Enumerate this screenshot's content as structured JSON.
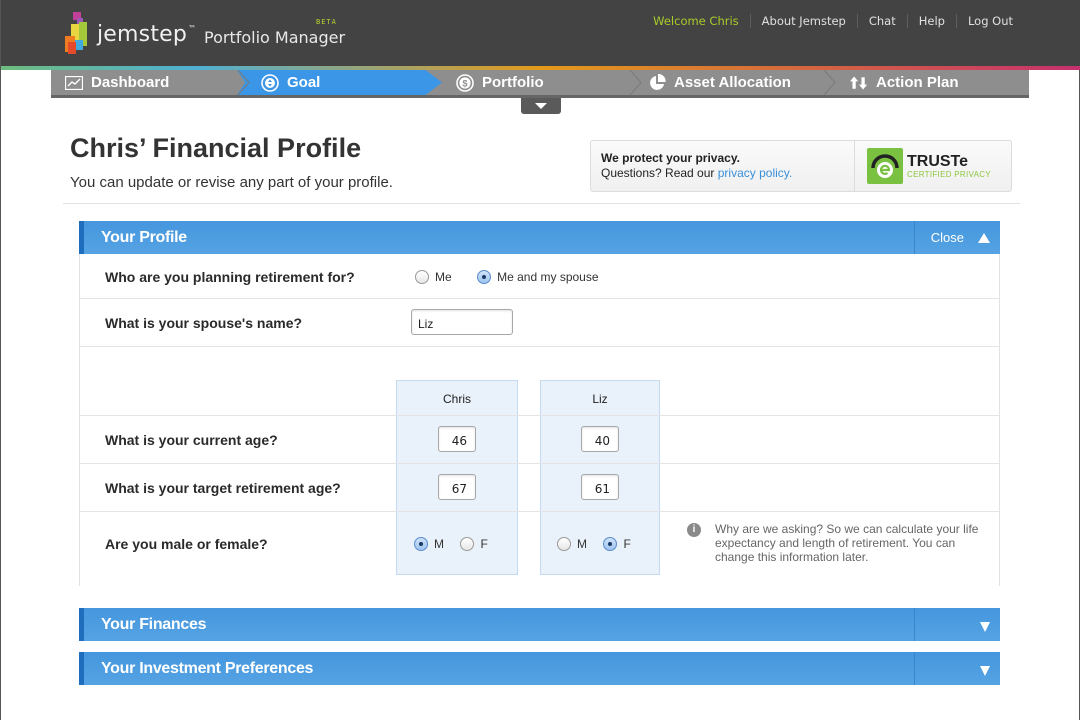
{
  "header": {
    "brand": "jemstep",
    "trademark": "™",
    "product": "Portfolio Manager",
    "beta": "BETA",
    "nav": [
      {
        "label": "Welcome Chris"
      },
      {
        "label": "About Jemstep"
      },
      {
        "label": "Chat"
      },
      {
        "label": "Help"
      },
      {
        "label": "Log Out"
      }
    ]
  },
  "steps": [
    {
      "label": "Dashboard",
      "icon": "chart-line-icon",
      "active": false
    },
    {
      "label": "Goal",
      "icon": "goal-icon",
      "active": true
    },
    {
      "label": "Portfolio",
      "icon": "dollar-circle-icon",
      "active": false
    },
    {
      "label": "Asset Allocation",
      "icon": "pie-chart-icon",
      "active": false
    },
    {
      "label": "Action Plan",
      "icon": "arrows-updown-icon",
      "active": false
    }
  ],
  "page": {
    "title": "Chris’ Financial Profile",
    "subtitle": "You can update or revise any part of your profile."
  },
  "privacy": {
    "heading": "We protect your privacy.",
    "text": "Questions? Read our ",
    "link": "privacy policy.",
    "truste": "TRUSTe",
    "truste_sub": "CERTIFIED PRIVACY"
  },
  "colors": {
    "accent_blue": "#3b96e8",
    "header_bg": "#434343",
    "welcome_green": "#a8cc2a",
    "truste_green": "#7ac142"
  },
  "profile": {
    "title": "Your Profile",
    "close_label": "Close",
    "q_planning": "Who are you planning retirement for?",
    "opt_me": "Me",
    "opt_me_spouse": "Me and my spouse",
    "planning_selected": "Me and my spouse",
    "q_spouse_name": "What is your spouse's name?",
    "spouse_name": "Liz",
    "q_current_age": "What is your current age?",
    "q_target_age": "What is your target retirement age?",
    "q_gender": "Are you male or female?",
    "male": "M",
    "female": "F",
    "people": [
      {
        "name": "Chris",
        "current_age": "46",
        "target_age": "67",
        "gender": "M"
      },
      {
        "name": "Liz",
        "current_age": "40",
        "target_age": "61",
        "gender": "F"
      }
    ],
    "info_text": "Why are we asking? So we can calculate your life expectancy and length of retirement. You can change this information later."
  },
  "sections": [
    {
      "title": "Your Finances"
    },
    {
      "title": "Your Investment Preferences"
    }
  ]
}
